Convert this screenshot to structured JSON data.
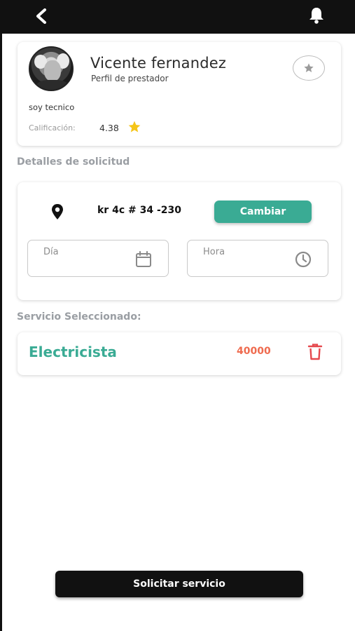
{
  "header": {
    "back_icon": "chevron-left-icon",
    "notifications_icon": "bell-icon"
  },
  "provider": {
    "name": "Vicente fernandez",
    "role": "Perfil de prestador",
    "description": "soy tecnico",
    "rating_label": "Calificación:",
    "rating_value": "4.38",
    "rating_icon": "star-icon",
    "favorite_icon": "star-outline-icon"
  },
  "details": {
    "section_title": "Detalles de solicitud",
    "address": "kr 4c # 34 -230",
    "location_icon": "map-pin-icon",
    "change_label": "Cambiar",
    "day_label": "Día",
    "day_icon": "calendar-icon",
    "hour_label": "Hora",
    "hour_icon": "clock-icon"
  },
  "service": {
    "section_title": "Servicio Seleccionado:",
    "name": "Electricista",
    "price": "40000",
    "delete_icon": "trash-icon"
  },
  "submit_label": "Solicitar servicio",
  "colors": {
    "topbar": "#111111",
    "accent": "#3aab94",
    "price": "#ef6b4f",
    "delete": "#e5484d",
    "star": "#f5c518",
    "section_title": "#9a9ea3"
  }
}
